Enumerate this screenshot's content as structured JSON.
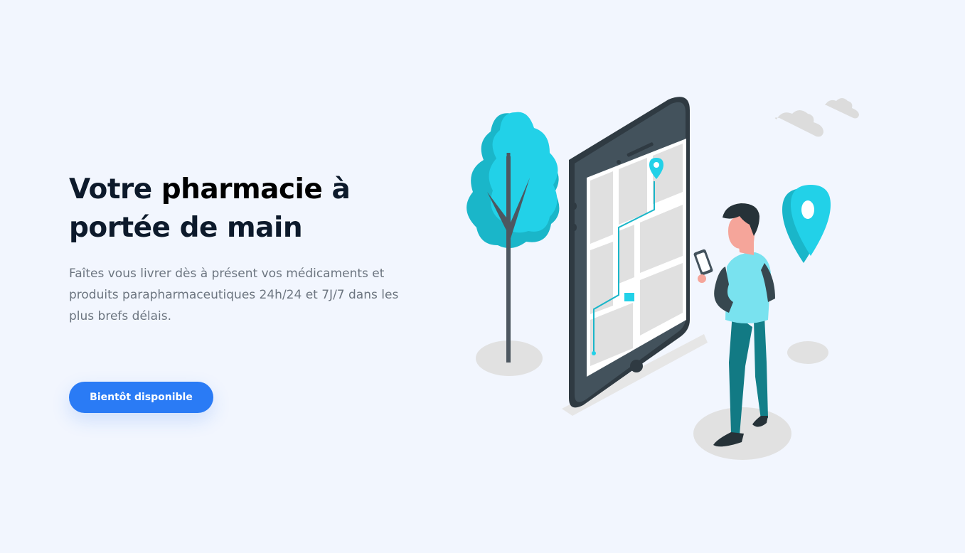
{
  "hero": {
    "headline_before": "Votre ",
    "headline_highlight": "pharmacie",
    "headline_after_1": " à",
    "headline_line2": "portée de main",
    "subtitle": "Faîtes vous livrer dès à présent vos médicaments et produits parapharmaceutiques 24h/24 et 7J/7 dans les plus brefs délais.",
    "cta_label": "Bientôt disponible"
  },
  "colors": {
    "background": "#f2f6fe",
    "accent_blue": "#2a7bf5",
    "accent_cyan": "#22cde6",
    "heading": "#0d1a2b",
    "body_text": "#6c7580"
  },
  "illustration": {
    "icons": [
      "tree-icon",
      "smartphone-map-icon",
      "person-icon",
      "location-pin-icon",
      "cloud-icon"
    ]
  }
}
